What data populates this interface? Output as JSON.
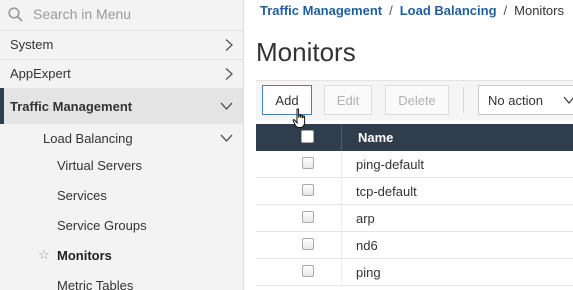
{
  "search": {
    "placeholder": "Search in Menu"
  },
  "sidebar": {
    "items": [
      {
        "label": "System"
      },
      {
        "label": "AppExpert"
      },
      {
        "label": "Traffic Management"
      },
      {
        "label": "Load Balancing"
      },
      {
        "label": "Virtual Servers"
      },
      {
        "label": "Services"
      },
      {
        "label": "Service Groups"
      },
      {
        "label": "Monitors"
      },
      {
        "label": "Metric Tables"
      }
    ]
  },
  "breadcrumb": {
    "items": [
      "Traffic Management",
      "Load Balancing",
      "Monitors"
    ],
    "separator": "/"
  },
  "page": {
    "title": "Monitors"
  },
  "toolbar": {
    "add_label": "Add",
    "edit_label": "Edit",
    "delete_label": "Delete",
    "action_select": "No action"
  },
  "table": {
    "columns": [
      "Name"
    ],
    "rows": [
      {
        "name": "ping-default"
      },
      {
        "name": "tcp-default"
      },
      {
        "name": "arp"
      },
      {
        "name": "nd6"
      },
      {
        "name": "ping"
      }
    ]
  },
  "colors": {
    "header_bg": "#2f3d4d",
    "link": "#1f5f9e",
    "active_indicator": "#2c3e50"
  }
}
